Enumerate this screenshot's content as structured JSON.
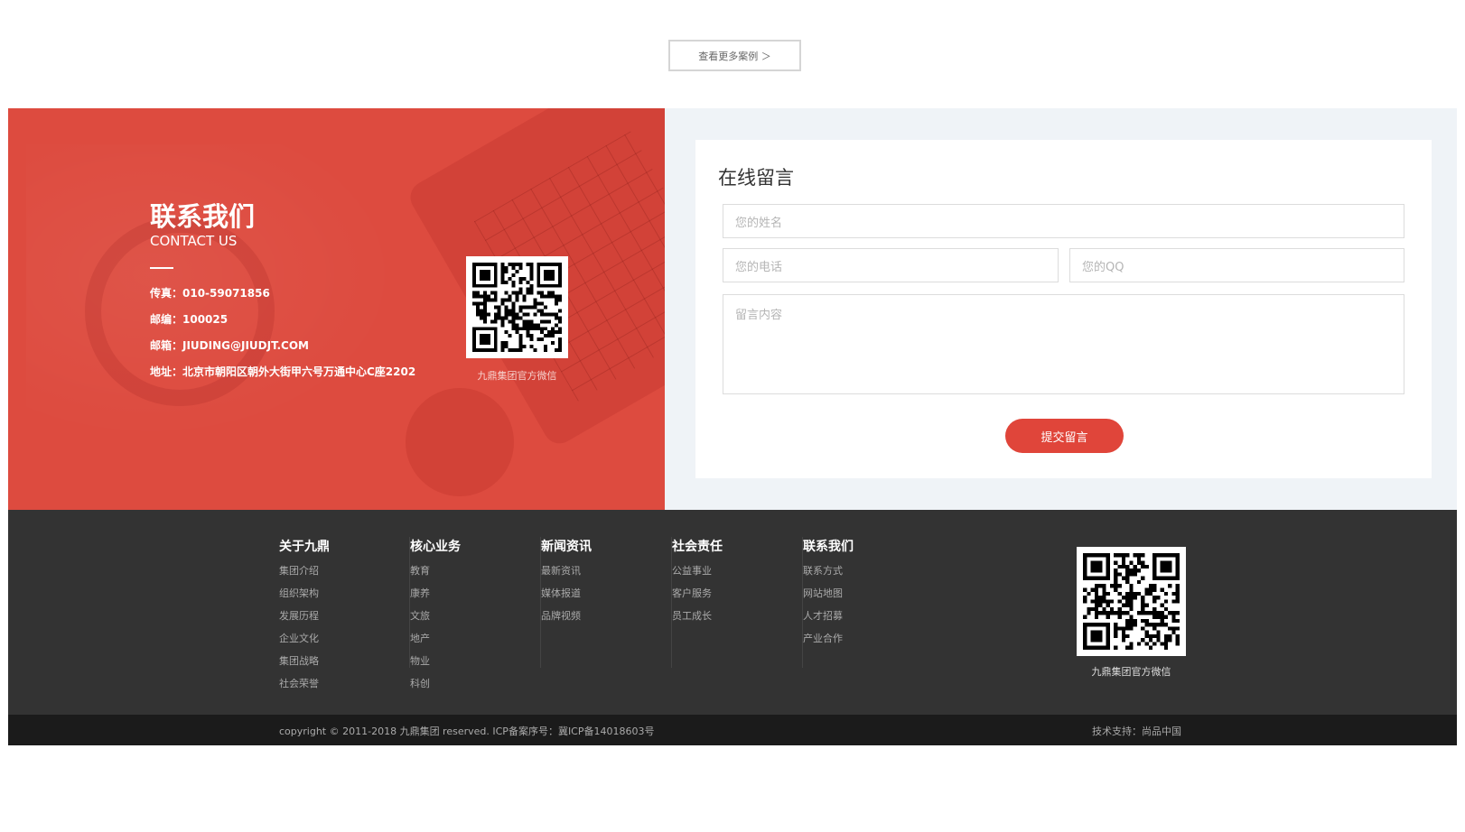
{
  "more_cases": "查看更多案例 ＞",
  "contact": {
    "title": "联系我们",
    "subtitle": "CONTACT US",
    "fax": "传真：010-59071856",
    "postcode": "邮编：100025",
    "email": "邮箱：JIUDING@JIUDJT.COM",
    "address": "地址：北京市朝阳区朝外大街甲六号万通中心C座2202",
    "qr_caption": "九鼎集团官方微信"
  },
  "form": {
    "title": "在线留言",
    "name_placeholder": "您的姓名",
    "phone_placeholder": "您的电话",
    "qq_placeholder": "您的QQ",
    "message_placeholder": "留言内容",
    "submit_label": "提交留言"
  },
  "footer": {
    "columns": [
      {
        "title": "关于九鼎",
        "links": [
          "集团介绍",
          "组织架构",
          "发展历程",
          "企业文化",
          "集团战略",
          "社会荣誉"
        ]
      },
      {
        "title": "核心业务",
        "links": [
          "教育",
          "康养",
          "文旅",
          "地产",
          "物业",
          "科创"
        ]
      },
      {
        "title": "新闻资讯",
        "links": [
          "最新资讯",
          "媒体报道",
          "品牌视频"
        ]
      },
      {
        "title": "社会责任",
        "links": [
          "公益事业",
          "客户服务",
          "员工成长"
        ]
      },
      {
        "title": "联系我们",
        "links": [
          "联系方式",
          "网站地图",
          "人才招募",
          "产业合作"
        ]
      }
    ],
    "qr_caption": "九鼎集团官方微信",
    "copyright": "copyright © 2011-2018 九鼎集团 reserved.    ICP备案序号：冀ICP备14018603号",
    "tech_support": "技术支持：尚品中国"
  },
  "colors": {
    "accent": "#dd4b3f",
    "submit": "#e0453a",
    "footer": "#333333",
    "footer_bottom": "#1b1b1b",
    "form_bg": "#eff3f7"
  }
}
